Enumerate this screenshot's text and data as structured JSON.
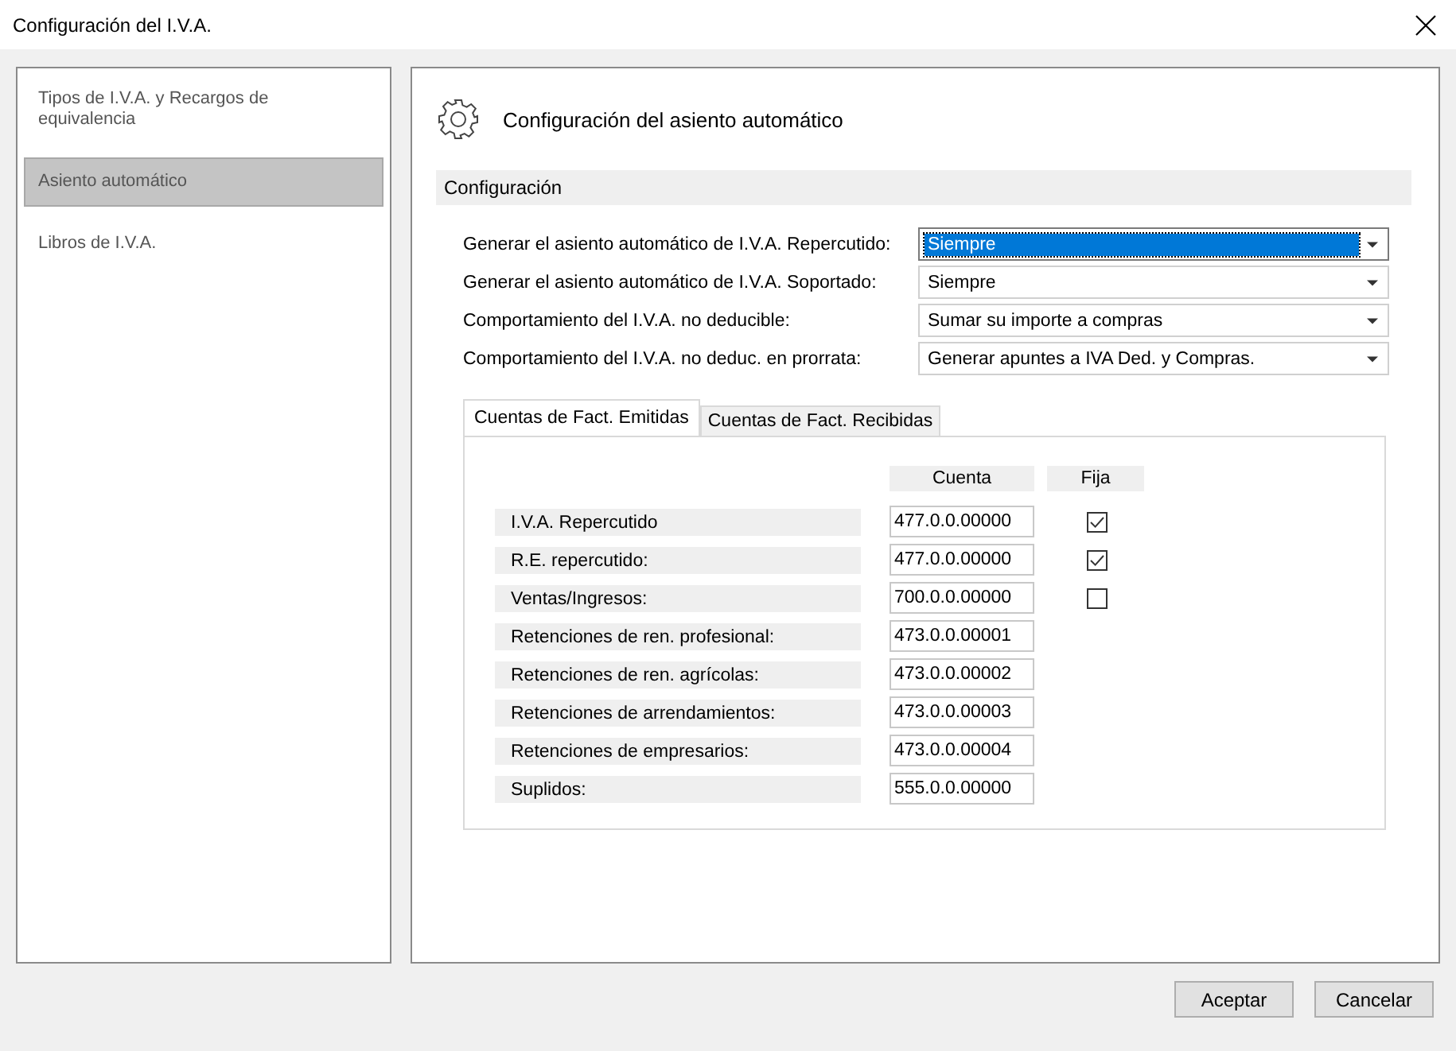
{
  "window": {
    "title": "Configuración del I.V.A."
  },
  "sidebar": {
    "items": [
      {
        "label": "Tipos de I.V.A. y Recargos de equivalencia",
        "selected": false
      },
      {
        "label": "Asiento automático",
        "selected": true
      },
      {
        "label": "Libros de I.V.A.",
        "selected": false
      }
    ]
  },
  "panel": {
    "title": "Configuración del asiento automático",
    "section": "Configuración",
    "settings": [
      {
        "label": "Generar el asiento automático de I.V.A. Repercutido:",
        "value": "Siempre",
        "focused": true
      },
      {
        "label": "Generar el asiento automático de I.V.A. Soportado:",
        "value": "Siempre",
        "focused": false
      },
      {
        "label": "Comportamiento del I.V.A. no deducible:",
        "value": "Sumar su importe a compras",
        "focused": false
      },
      {
        "label": "Comportamiento del I.V.A. no deduc. en prorrata:",
        "value": "Generar apuntes a IVA Ded. y Compras.",
        "focused": false
      }
    ],
    "tabs": [
      {
        "label": "Cuentas de Fact. Emitidas",
        "selected": true
      },
      {
        "label": "Cuentas de Fact. Recibidas",
        "selected": false
      }
    ],
    "table": {
      "columns": [
        "Cuenta",
        "Fija"
      ],
      "rows": [
        {
          "label": "I.V.A. Repercutido",
          "account": "477.0.0.00000",
          "kind": "check",
          "checked": true
        },
        {
          "label": "R.E. repercutido:",
          "account": "477.0.0.00000",
          "kind": "check",
          "checked": true
        },
        {
          "label": "Ventas/Ingresos:",
          "account": "700.0.0.00000",
          "kind": "check",
          "checked": false
        },
        {
          "label": "Retenciones de ren. profesional:",
          "account": "473.0.0.00001",
          "kind": "plain"
        },
        {
          "label": "Retenciones de ren. agrícolas:",
          "account": "473.0.0.00002",
          "kind": "plain"
        },
        {
          "label": "Retenciones de arrendamientos:",
          "account": "473.0.0.00003",
          "kind": "plain"
        },
        {
          "label": "Retenciones de empresarios:",
          "account": "473.0.0.00004",
          "kind": "plain"
        },
        {
          "label": "Suplidos:",
          "account": "555.0.0.00000",
          "kind": "plain"
        }
      ]
    }
  },
  "buttons": [
    "Aceptar",
    "Cancelar"
  ]
}
